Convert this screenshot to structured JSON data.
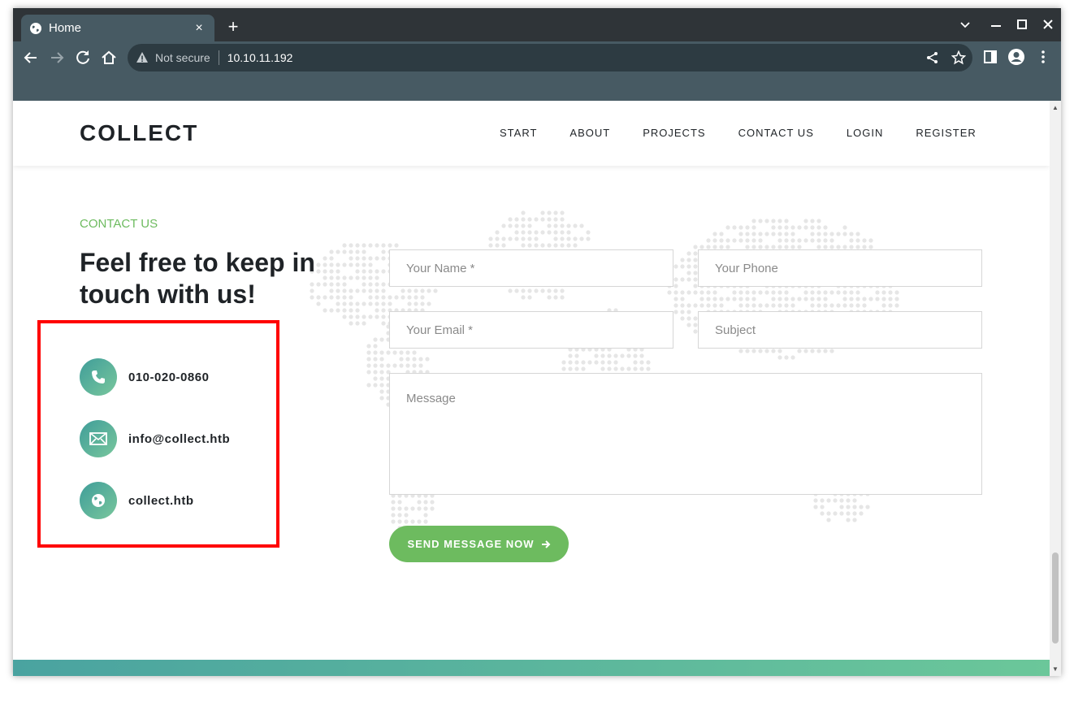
{
  "browser": {
    "tab_title": "Home",
    "tab_close": "×",
    "new_tab": "+",
    "not_secure": "Not secure",
    "url": "10.10.11.192"
  },
  "site": {
    "logo": "COLLECT",
    "nav": [
      "START",
      "ABOUT",
      "PROJECTS",
      "CONTACT US",
      "LOGIN",
      "REGISTER"
    ]
  },
  "contact": {
    "eyebrow": "CONTACT US",
    "headline": "Feel free to keep in touch with us!",
    "phone": "010-020-0860",
    "email": "info@collect.htb",
    "website": "collect.htb"
  },
  "form": {
    "name_placeholder": "Your Name *",
    "phone_placeholder": "Your Phone",
    "email_placeholder": "Your Email *",
    "subject_placeholder": "Subject",
    "message_placeholder": "Message",
    "send_label": "SEND MESSAGE NOW"
  },
  "colors": {
    "accent_green": "#6dbb5f",
    "icon_gradient_start": "#3f9d9a",
    "icon_gradient_end": "#79c79c",
    "chrome_toolbar": "#475a63",
    "highlight_red": "#ff0000"
  }
}
